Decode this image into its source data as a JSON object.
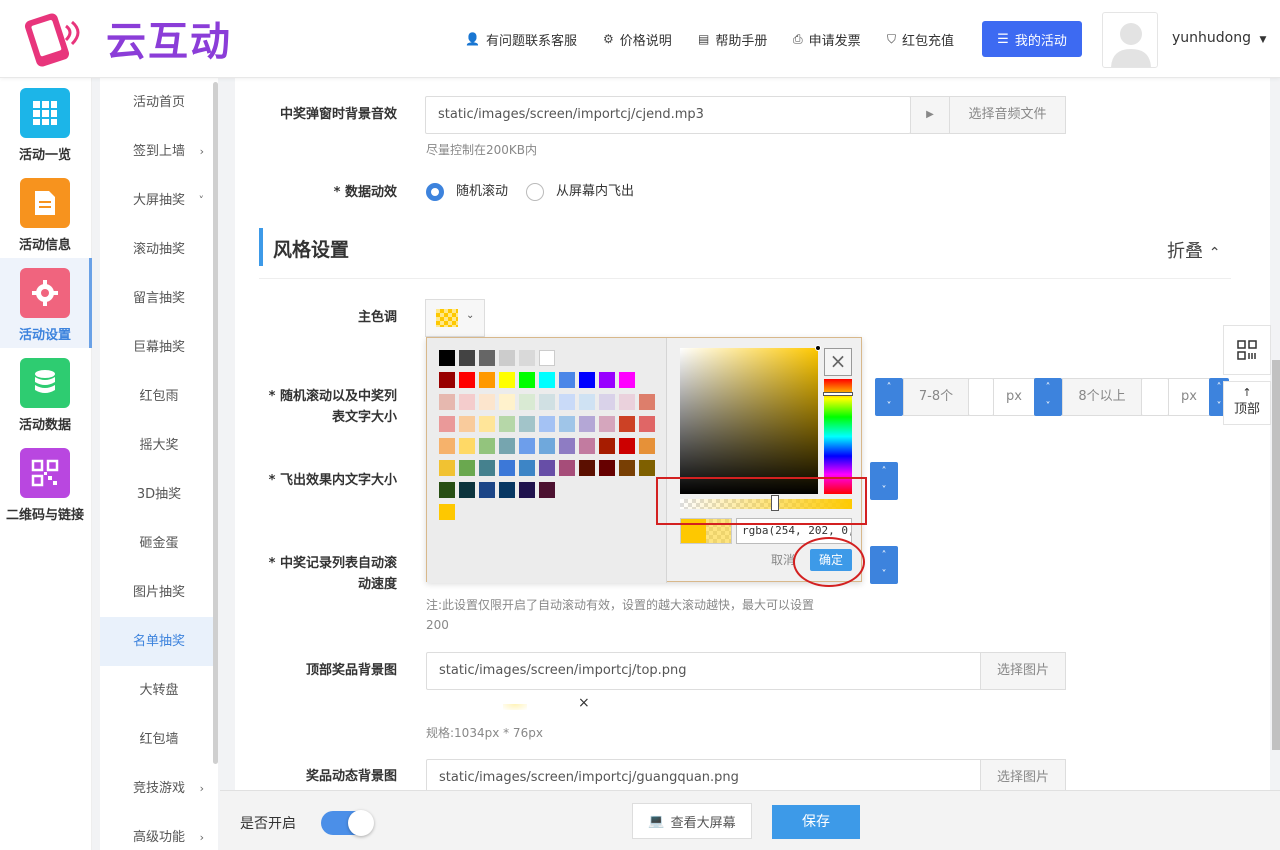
{
  "header": {
    "logo_text": "云互动",
    "nav": [
      {
        "label": "有问题联系客服",
        "icon": "user-plus-icon"
      },
      {
        "label": "价格说明",
        "icon": "gear-icon"
      },
      {
        "label": "帮助手册",
        "icon": "book-icon"
      },
      {
        "label": "申请发票",
        "icon": "printer-icon"
      },
      {
        "label": "红包充值",
        "icon": "shield-check-icon"
      }
    ],
    "my_activity": "我的活动",
    "username": "yunhudong"
  },
  "iconbar": [
    {
      "label": "活动一览",
      "color": "#1cb5e8",
      "icon": "grid-icon"
    },
    {
      "label": "活动信息",
      "color": "#f7931e",
      "icon": "document-icon"
    },
    {
      "label": "活动设置",
      "color": "#f0647e",
      "icon": "gear-icon",
      "active": true
    },
    {
      "label": "活动数据",
      "color": "#2ecc71",
      "icon": "database-icon"
    },
    {
      "label": "二维码与链接",
      "color": "#b947e0",
      "icon": "qrcode-icon"
    }
  ],
  "submenu": [
    {
      "label": "活动首页"
    },
    {
      "label": "签到上墙",
      "arrow": "›"
    },
    {
      "label": "大屏抽奖",
      "arrow": "˅"
    },
    {
      "label": "滚动抽奖"
    },
    {
      "label": "留言抽奖"
    },
    {
      "label": "巨幕抽奖"
    },
    {
      "label": "红包雨"
    },
    {
      "label": "摇大奖"
    },
    {
      "label": "3D抽奖"
    },
    {
      "label": "砸金蛋"
    },
    {
      "label": "图片抽奖"
    },
    {
      "label": "名单抽奖",
      "active": true
    },
    {
      "label": "大转盘"
    },
    {
      "label": "红包墙"
    },
    {
      "label": "竞技游戏",
      "arrow": "›"
    },
    {
      "label": "高级功能",
      "arrow": "›"
    }
  ],
  "form": {
    "bg_music_label": "中奖弹窗时背景音效",
    "bg_music_value": "static/images/screen/importcj/cjend.mp3",
    "bg_music_play": "▶",
    "bg_music_btn": "选择音频文件",
    "bg_music_hint": "尽量控制在200KB内",
    "anim_label": "* 数据动效",
    "anim_opt1": "随机滚动",
    "anim_opt2": "从屏幕内飞出",
    "section_title": "风格设置",
    "collapse": "折叠",
    "main_color_label": "主色调",
    "font_size_label_1": "* 随机滚动以及中奖列",
    "font_size_label_2": "表文字大小",
    "range1": "7-8个",
    "unit1": "px",
    "range2": "8个以上",
    "unit2": "px",
    "fly_label": "* 飞出效果内文字大小",
    "speed_label_1": "* 中奖记录列表自动滚",
    "speed_label_2": "动速度",
    "speed_hint_1": "注:此设置仅限开启了自动滚动有效，设置的越大滚动越快，最大可以设置",
    "speed_hint_2": "200",
    "top_bg_label": "顶部奖品背景图",
    "top_bg_value": "static/images/screen/importcj/top.png",
    "top_bg_btn": "选择图片",
    "top_bg_remove": "×",
    "top_bg_spec": "规格:1034px * 76px",
    "prize_bg_label": "奖品动态背景图",
    "prize_bg_value": "static/images/screen/importcj/guangquan.png",
    "prize_bg_btn": "选择图片"
  },
  "picker": {
    "rgba": "rgba(254, 202, 0, 0.5)",
    "cancel": "取消",
    "ok": "确定",
    "close": "×",
    "palette": [
      [
        "#000000",
        "#434343",
        "#666666",
        "#cccccc",
        "#d9d9d9",
        "#ffffff"
      ],
      [
        "#980000",
        "#ff0000",
        "#ff9900",
        "#ffff00",
        "#00ff00",
        "#00ffff",
        "#4a86e8",
        "#0000ff",
        "#9900ff",
        "#ff00ff"
      ],
      [
        "#e6b8af",
        "#f4cccc",
        "#fce5cd",
        "#fff2cc",
        "#d9ead3",
        "#d0e0e3",
        "#c9daf8",
        "#cfe2f3",
        "#d9d2e9",
        "#ead1dc",
        "#dd7e6b"
      ],
      [
        "#ea9999",
        "#f9cb9c",
        "#ffe599",
        "#b6d7a8",
        "#a2c4c9",
        "#a4c2f4",
        "#9fc5e8",
        "#b4a7d6",
        "#d5a6bd",
        "#cc4125",
        "#e06666"
      ],
      [
        "#f6b26b",
        "#ffd966",
        "#93c47d",
        "#76a5af",
        "#6d9eeb",
        "#6fa8dc",
        "#8e7cc3",
        "#c27ba0",
        "#a61c00",
        "#cc0000",
        "#e69138"
      ],
      [
        "#f1c232",
        "#6aa84f",
        "#45818e",
        "#3c78d8",
        "#3d85c6",
        "#674ea7",
        "#a64d79",
        "#5b0f00",
        "#660000",
        "#783f04",
        "#7f6000"
      ],
      [
        "#274e13",
        "#0c343d",
        "#1c4587",
        "#073763",
        "#20124d",
        "#4c1130"
      ],
      [
        "#fec800"
      ]
    ]
  },
  "float": {
    "top": "顶部",
    "top_arrow": "↑"
  },
  "bottom": {
    "switch_label": "是否开启",
    "view_btn": "查看大屏幕",
    "save_btn": "保存"
  }
}
